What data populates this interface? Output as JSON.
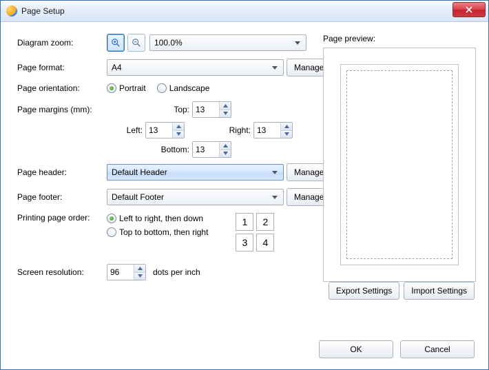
{
  "window": {
    "title": "Page Setup"
  },
  "labels": {
    "zoom": "Diagram zoom:",
    "format": "Page format:",
    "orientation": "Page orientation:",
    "margins": "Page margins (mm):",
    "top": "Top:",
    "left": "Left:",
    "right": "Right:",
    "bottom": "Bottom:",
    "header": "Page header:",
    "footer": "Page footer:",
    "order": "Printing page order:",
    "resolution": "Screen resolution:",
    "dpi": "dots per inch",
    "preview": "Page preview:"
  },
  "zoom": {
    "value": "100.0%"
  },
  "format": {
    "value": "A4",
    "manage": "Manage"
  },
  "orientation": {
    "portrait": "Portrait",
    "landscape": "Landscape",
    "selected": "portrait"
  },
  "margins": {
    "top": "13",
    "left": "13",
    "right": "13",
    "bottom": "13"
  },
  "header": {
    "value": "Default Header",
    "manage": "Manage"
  },
  "footer": {
    "value": "Default Footer",
    "manage": "Manage"
  },
  "order": {
    "ltr": "Left to right, then down",
    "ttb": "Top to bottom, then right",
    "selected": "ltr",
    "cells": [
      "1",
      "2",
      "3",
      "4"
    ]
  },
  "resolution": {
    "value": "96"
  },
  "buttons": {
    "export": "Export Settings",
    "import": "Import Settings",
    "ok": "OK",
    "cancel": "Cancel"
  }
}
